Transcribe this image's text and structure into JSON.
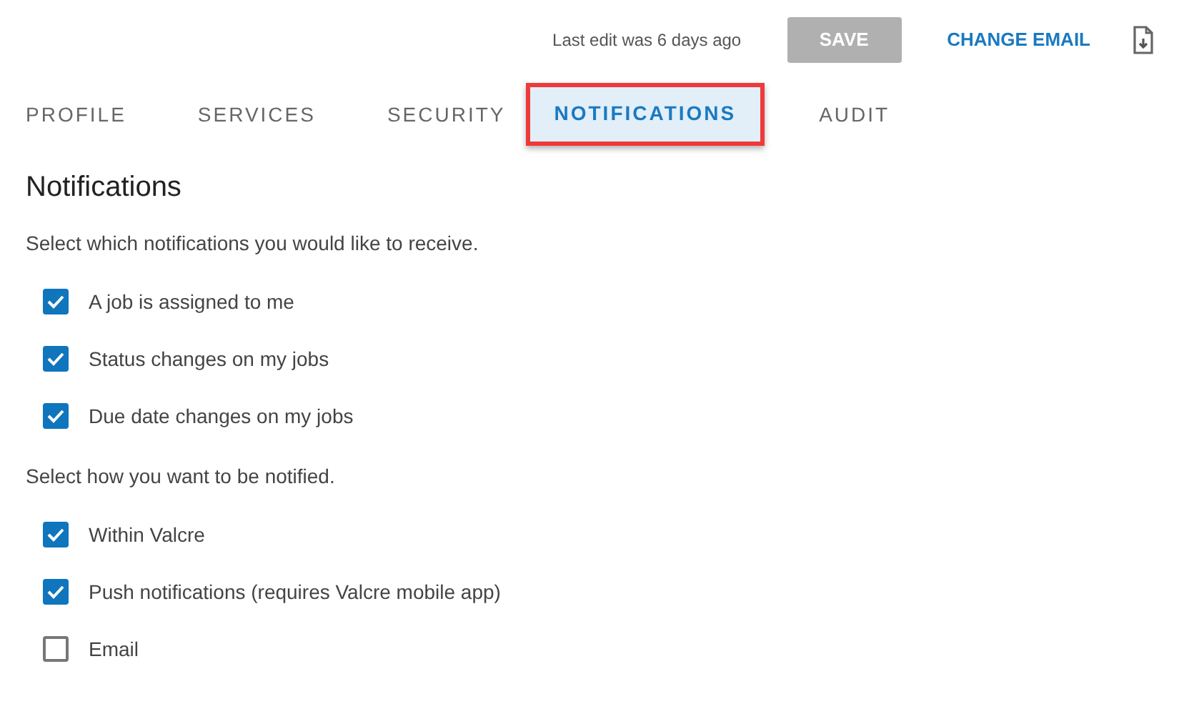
{
  "header": {
    "last_edit": "Last edit was 6 days ago",
    "save_button": {
      "label": "SAVE",
      "disabled": true
    },
    "change_email": "CHANGE EMAIL"
  },
  "tabs": [
    {
      "label": "PROFILE",
      "selected": false,
      "highlighted": false
    },
    {
      "label": "SERVICES",
      "selected": false,
      "highlighted": false
    },
    {
      "label": "SECURITY",
      "selected": false,
      "highlighted": false
    },
    {
      "label": "NOTIFICATIONS",
      "selected": true,
      "highlighted": true
    },
    {
      "label": "AUDIT",
      "selected": false,
      "highlighted": false
    }
  ],
  "title": "Notifications",
  "sections": [
    {
      "prompt": "Select which notifications you would like to receive.",
      "options": [
        {
          "label": "A job is assigned to me",
          "checked": true
        },
        {
          "label": "Status changes on my jobs",
          "checked": true
        },
        {
          "label": "Due date changes on my jobs",
          "checked": true
        }
      ]
    },
    {
      "prompt": "Select how you want to be notified.",
      "options": [
        {
          "label": "Within Valcre",
          "checked": true
        },
        {
          "label": "Push notifications (requires Valcre mobile app)",
          "checked": true
        },
        {
          "label": "Email",
          "checked": false
        }
      ]
    }
  ]
}
